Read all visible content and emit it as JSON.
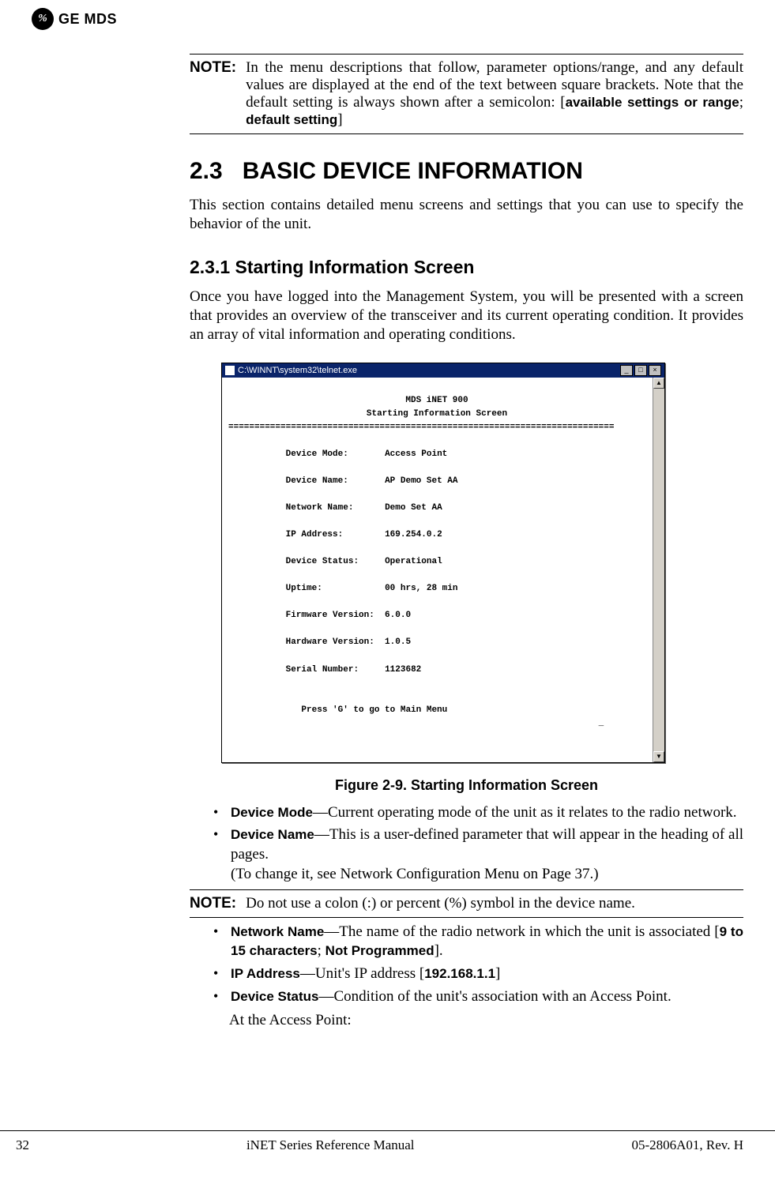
{
  "header": {
    "logo_initials": "%",
    "logo_text": "GE MDS"
  },
  "note1": {
    "label": "NOTE:",
    "text_part1": "In the menu descriptions that follow, parameter options/range, and any default values are displayed at the end of the text between square brackets. Note that the default setting is always shown after a semicolon: [",
    "bold1": "available settings or range",
    "sep": "; ",
    "bold2": "default setting",
    "text_part2": "]"
  },
  "section": {
    "number": "2.3",
    "title": "BASIC DEVICE INFORMATION",
    "intro": "This section contains detailed menu screens and settings that you can use to specify the behavior of the unit."
  },
  "subsection": {
    "title": "2.3.1 Starting Information Screen",
    "intro": "Once you have logged into the Management System, you will be presented with a screen that provides an overview of the transceiver and its current operating condition. It provides an array of vital information and operating conditions."
  },
  "terminal": {
    "window_title": "C:\\WINNT\\system32\\telnet.exe",
    "header1": "MDS iNET 900",
    "header2": "Starting Information Screen",
    "rule": "==========================================================================",
    "rows": [
      {
        "label": "Device Mode:",
        "value": "Access Point"
      },
      {
        "label": "Device Name:",
        "value": "AP Demo Set AA"
      },
      {
        "label": "Network Name:",
        "value": "Demo Set AA"
      },
      {
        "label": "IP Address:",
        "value": "169.254.0.2"
      },
      {
        "label": "Device Status:",
        "value": "Operational"
      },
      {
        "label": "Uptime:",
        "value": "00 hrs, 28 min"
      },
      {
        "label": "Firmware Version:",
        "value": "6.0.0"
      },
      {
        "label": "Hardware Version:",
        "value": "1.0.5"
      },
      {
        "label": "Serial Number:",
        "value": "1123682"
      }
    ],
    "footer_hint": "Press 'G' to go to Main Menu"
  },
  "figure_caption": "Figure 2-9. Starting Information Screen",
  "params1": {
    "device_mode_label": "Device Mode",
    "device_mode_desc": "—Current operating mode of the unit as it relates to the radio network.",
    "device_name_label": "Device Name",
    "device_name_desc1": "—This is a user-defined parameter that will appear in the heading of all pages.",
    "device_name_desc2": "(To change it, see Network Configuration Menu on Page 37.)"
  },
  "note2": {
    "label": "NOTE:",
    "text": "Do not use a colon (:) or percent (%) symbol in the device name."
  },
  "params2": {
    "network_name_label": "Network Name",
    "network_name_desc1": "—The name of the radio network in which the unit is associated [",
    "network_name_bold1": "9 to 15 characters",
    "network_name_sep": "; ",
    "network_name_bold2": "Not Programmed",
    "network_name_desc2": "].",
    "ip_address_label": "IP Address",
    "ip_address_desc1": "—Unit's IP address [",
    "ip_address_bold": "192.168.1.1",
    "ip_address_desc2": "]",
    "device_status_label": "Device Status",
    "device_status_desc": "—Condition of the unit's association with an Access Point."
  },
  "sub_para": "At the Access Point:",
  "footer": {
    "page": "32",
    "center": "iNET Series Reference Manual",
    "right": "05-2806A01, Rev. H"
  }
}
